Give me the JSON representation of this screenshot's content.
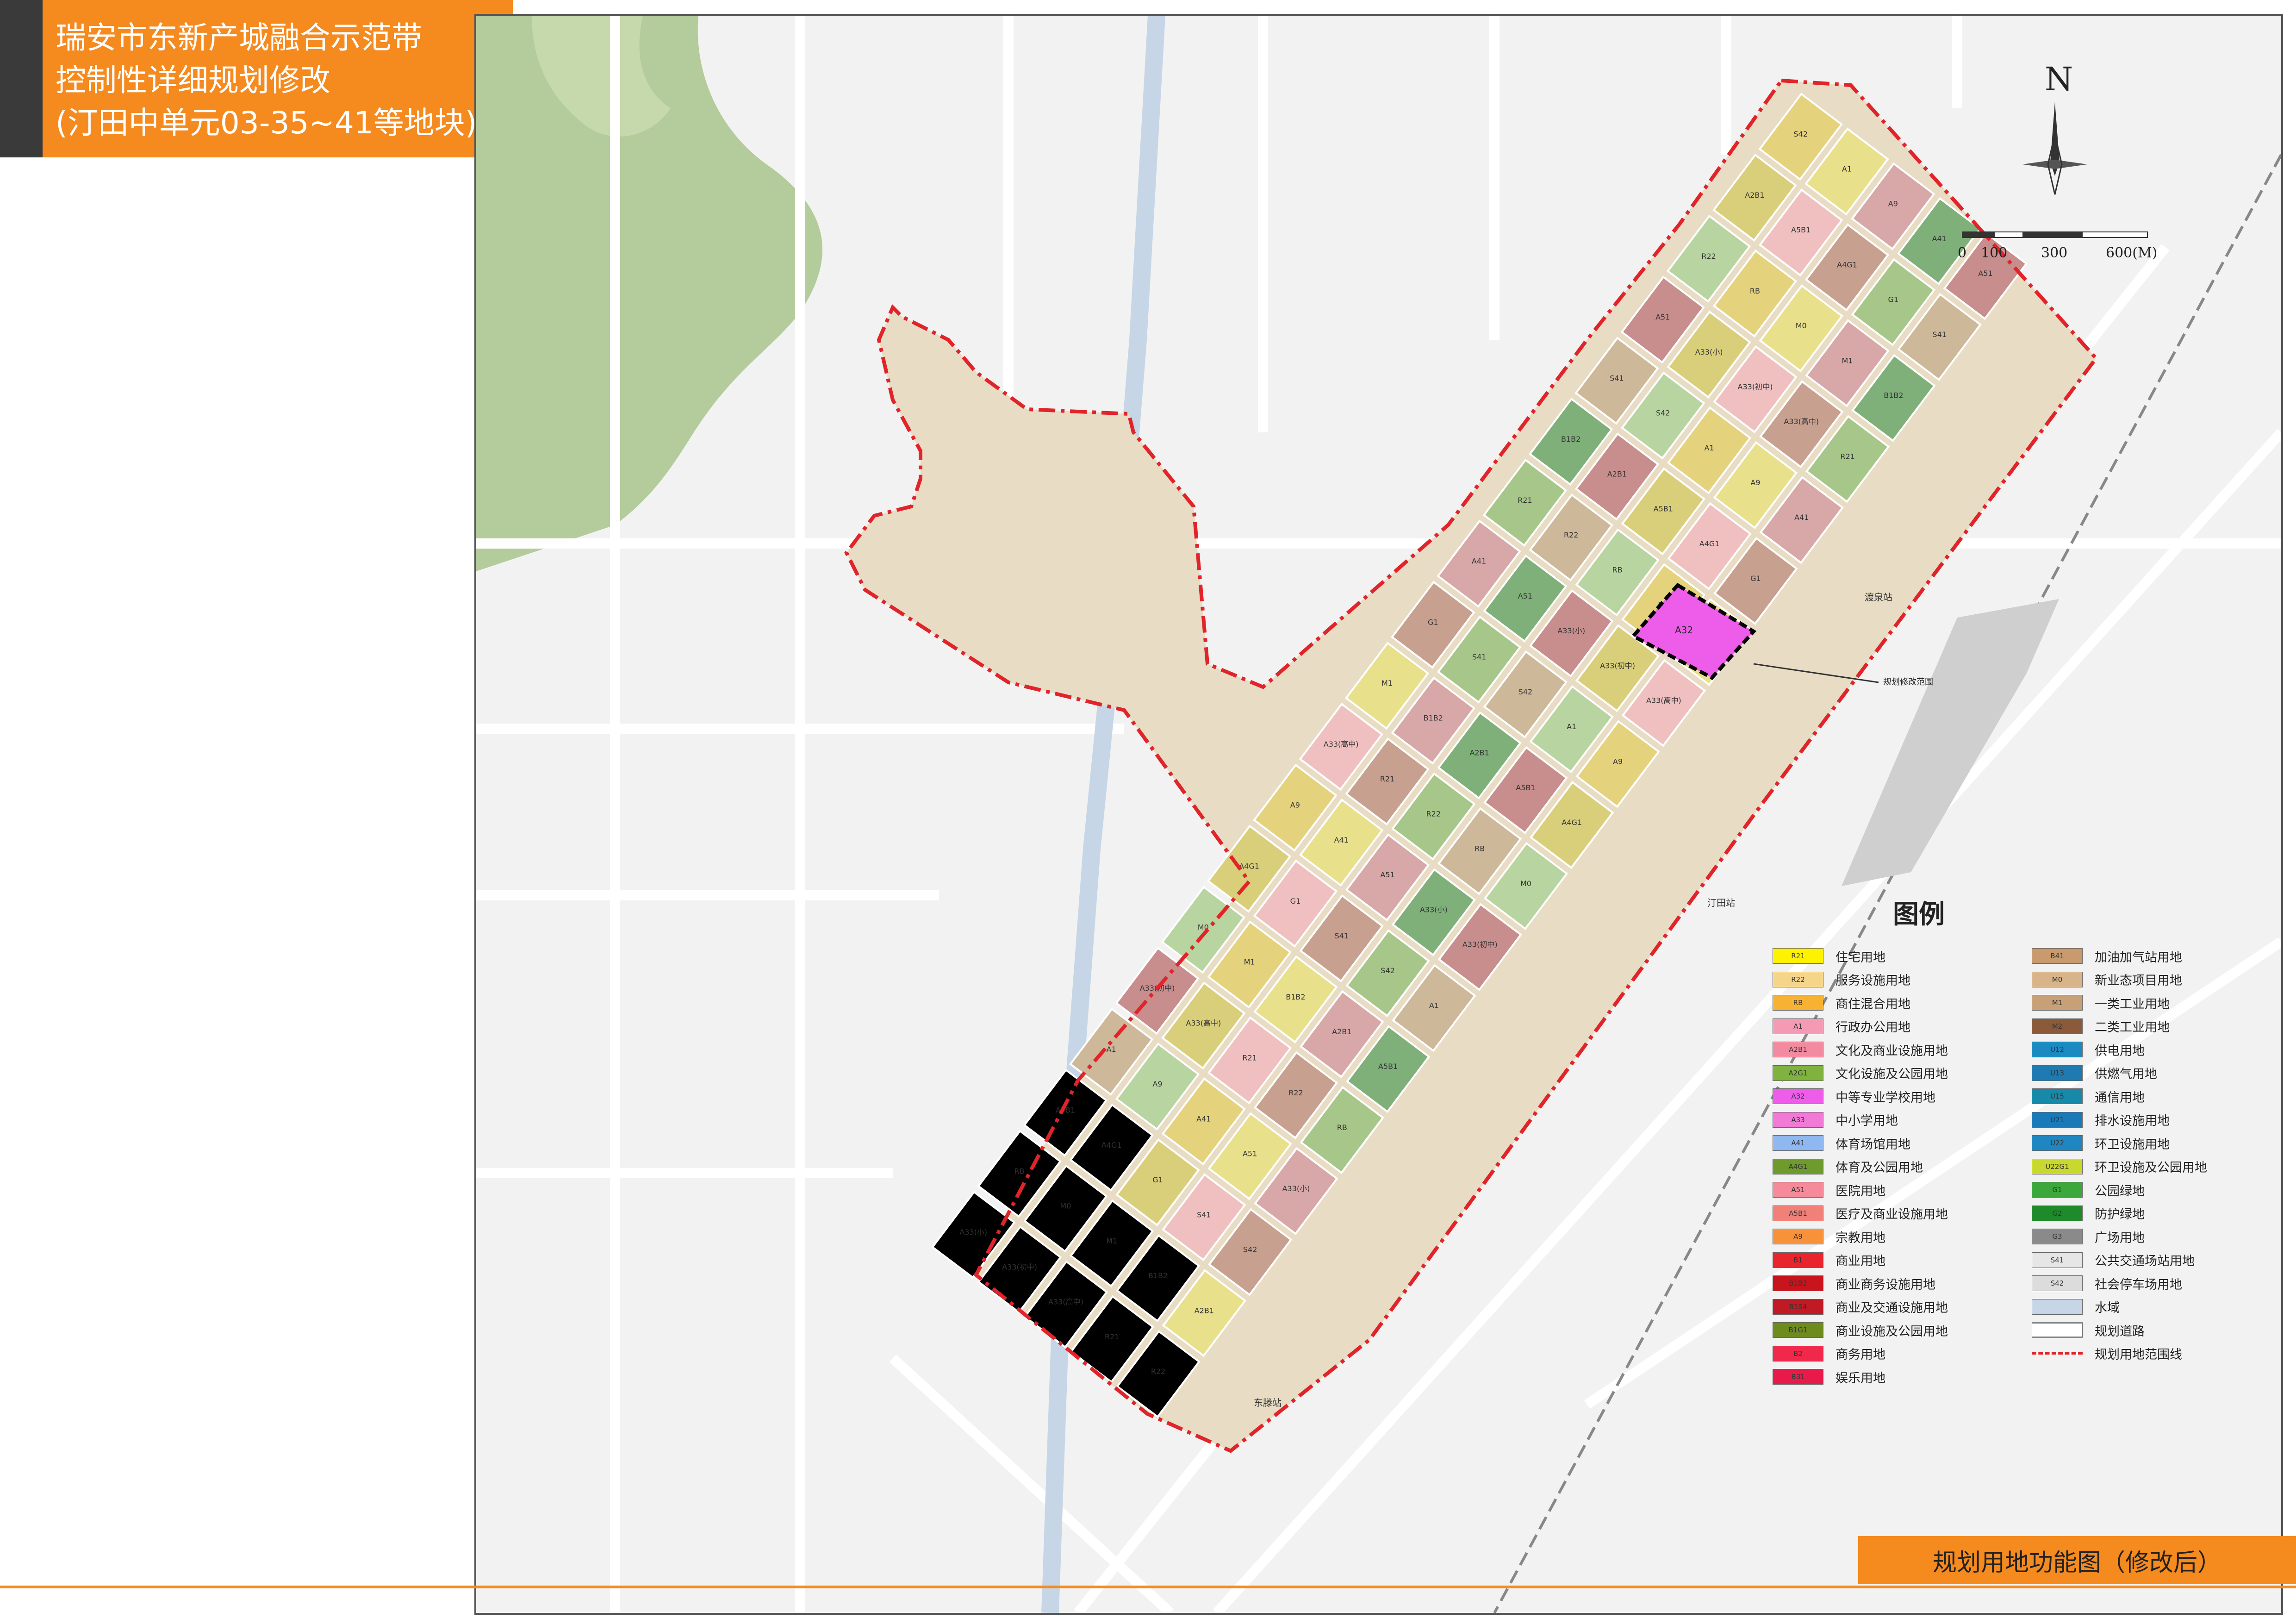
{
  "title": {
    "line1": "瑞安市东新产城融合示范带",
    "line2": "控制性详细规划修改",
    "line3": "(汀田中单元03-35~41等地块)"
  },
  "footer": {
    "label": "规划用地功能图（修改后）"
  },
  "north_arrow": {
    "letter": "N"
  },
  "scale_bar": {
    "ticks": [
      "0",
      "100",
      "300",
      "600(M)"
    ]
  },
  "callout": {
    "label": "规划修改范围",
    "parcel_code": "A32"
  },
  "stations": [
    "渡泉站",
    "汀田站",
    "东滕站"
  ],
  "colors": {
    "title_bg": "#f58a1f",
    "boundary": "#e0242a",
    "map_bg": "#f2f2f2",
    "road": "#ffffff",
    "water": "#c6d6e6",
    "mountain": "#a9c48c"
  },
  "legend": {
    "title": "图例",
    "items": [
      {
        "code": "R21",
        "label": "住宅用地",
        "color": "#fff200"
      },
      {
        "code": "R22",
        "label": "服务设施用地",
        "color": "#f5d58a"
      },
      {
        "code": "RB",
        "label": "商住混合用地",
        "color": "#f7b233"
      },
      {
        "code": "A1",
        "label": "行政办公用地",
        "color": "#f59ab5"
      },
      {
        "code": "A2B1",
        "label": "文化及商业设施用地",
        "color": "#f28aa0"
      },
      {
        "code": "A2G1",
        "label": "文化设施及公园用地",
        "color": "#7fb23f"
      },
      {
        "code": "A32",
        "label": "中等专业学校用地",
        "color": "#ee5cea"
      },
      {
        "code": "A33",
        "label": "中小学用地",
        "color": "#f07ad6"
      },
      {
        "code": "A41",
        "label": "体育场馆用地",
        "color": "#8fb8f0"
      },
      {
        "code": "A4G1",
        "label": "体育及公园用地",
        "color": "#6f9a2e"
      },
      {
        "code": "A51",
        "label": "医院用地",
        "color": "#f58a9a"
      },
      {
        "code": "A5B1",
        "label": "医疗及商业设施用地",
        "color": "#f08078"
      },
      {
        "code": "A9",
        "label": "宗教用地",
        "color": "#f7923b"
      },
      {
        "code": "B1",
        "label": "商业用地",
        "color": "#e8242c"
      },
      {
        "code": "B1B2",
        "label": "商业商务设施用地",
        "color": "#c8141c"
      },
      {
        "code": "B1S4",
        "label": "商业及交通设施用地",
        "color": "#c01a24"
      },
      {
        "code": "B1G1",
        "label": "商业设施及公园用地",
        "color": "#6e8c1e"
      },
      {
        "code": "B2",
        "label": "商务用地",
        "color": "#f0284a"
      },
      {
        "code": "B31",
        "label": "娱乐用地",
        "color": "#e81a4a"
      },
      {
        "code": "B41",
        "label": "加油加气站用地",
        "color": "#c89a6e"
      },
      {
        "code": "M0",
        "label": "新业态项目用地",
        "color": "#d8b48a"
      },
      {
        "code": "M1",
        "label": "一类工业用地",
        "color": "#c8a078"
      },
      {
        "code": "M2",
        "label": "二类工业用地",
        "color": "#8a5a3a"
      },
      {
        "code": "U12",
        "label": "供电用地",
        "color": "#1a8ac0"
      },
      {
        "code": "U13",
        "label": "供燃气用地",
        "color": "#1e7ab0"
      },
      {
        "code": "U15",
        "label": "通信用地",
        "color": "#168aa8"
      },
      {
        "code": "U21",
        "label": "排水设施用地",
        "color": "#1a7ab8"
      },
      {
        "code": "U22",
        "label": "环卫设施用地",
        "color": "#1e86c0"
      },
      {
        "code": "U22G1",
        "label": "环卫设施及公园用地",
        "color": "#c8d82e"
      },
      {
        "code": "G1",
        "label": "公园绿地",
        "color": "#3ca83c"
      },
      {
        "code": "G2",
        "label": "防护绿地",
        "color": "#1e8a2a"
      },
      {
        "code": "G3",
        "label": "广场用地",
        "color": "#8a8a8a"
      },
      {
        "code": "S41",
        "label": "公共交通场站用地",
        "color": "#e6e6e6"
      },
      {
        "code": "S42",
        "label": "社会停车场用地",
        "color": "#dcdcdc"
      },
      {
        "code": "",
        "label": "水域",
        "color": "#c6d6e6"
      },
      {
        "code": "",
        "label": "规划道路",
        "color": "#ffffff"
      },
      {
        "code": "",
        "label": "规划用地范围线",
        "color": "#e0242a"
      }
    ]
  },
  "parcel_labels": [
    "A33(小)",
    "A33(初中)",
    "A33(高中)",
    "R21",
    "R22",
    "RB",
    "M0",
    "M1",
    "B1B2",
    "A2B1",
    "A5B1",
    "A4G1",
    "G1",
    "S41",
    "S42",
    "A1",
    "A9",
    "A41",
    "A51"
  ]
}
